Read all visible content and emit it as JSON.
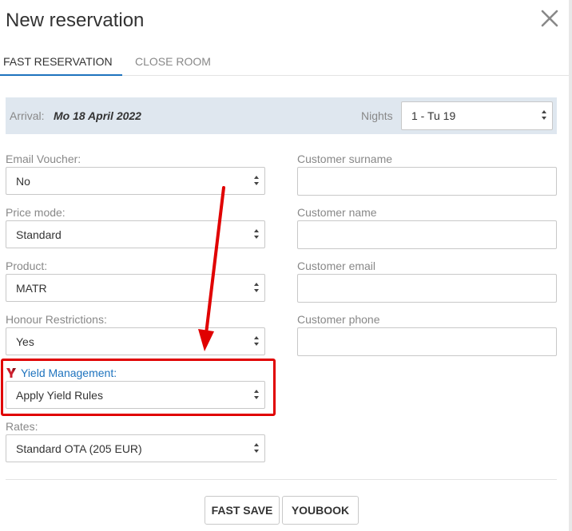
{
  "modal": {
    "title": "New reservation"
  },
  "tabs": [
    {
      "label": "FAST RESERVATION",
      "active": true
    },
    {
      "label": "CLOSE ROOM",
      "active": false
    }
  ],
  "arrival": {
    "label": "Arrival:",
    "date": "Mo 18 April 2022",
    "nights_label": "Nights",
    "nights_value": "1 - Tu 19"
  },
  "left_fields": {
    "email_voucher": {
      "label": "Email Voucher:",
      "value": "No"
    },
    "price_mode": {
      "label": "Price mode:",
      "value": "Standard"
    },
    "product": {
      "label": "Product:",
      "value": "MATR"
    },
    "honour_restrictions": {
      "label": "Honour Restrictions:",
      "value": "Yes"
    },
    "yield_management": {
      "label": "Yield Management:",
      "value": "Apply Yield Rules"
    },
    "rates": {
      "label": "Rates:",
      "value": "Standard OTA (205 EUR)"
    }
  },
  "right_fields": {
    "customer_surname": {
      "label": "Customer surname",
      "value": ""
    },
    "customer_name": {
      "label": "Customer name",
      "value": ""
    },
    "customer_email": {
      "label": "Customer email",
      "value": ""
    },
    "customer_phone": {
      "label": "Customer phone",
      "value": ""
    }
  },
  "buttons": {
    "fast_save": "FAST SAVE",
    "youbook": "YOUBOOK"
  },
  "colors": {
    "accent": "#1e73be",
    "annotation": "#e00000",
    "arrival_bar": "#dfe7ef"
  },
  "icons": {
    "close": "close-icon",
    "select_caret": "sort-caret-icon",
    "yield": "yield-management-icon"
  }
}
